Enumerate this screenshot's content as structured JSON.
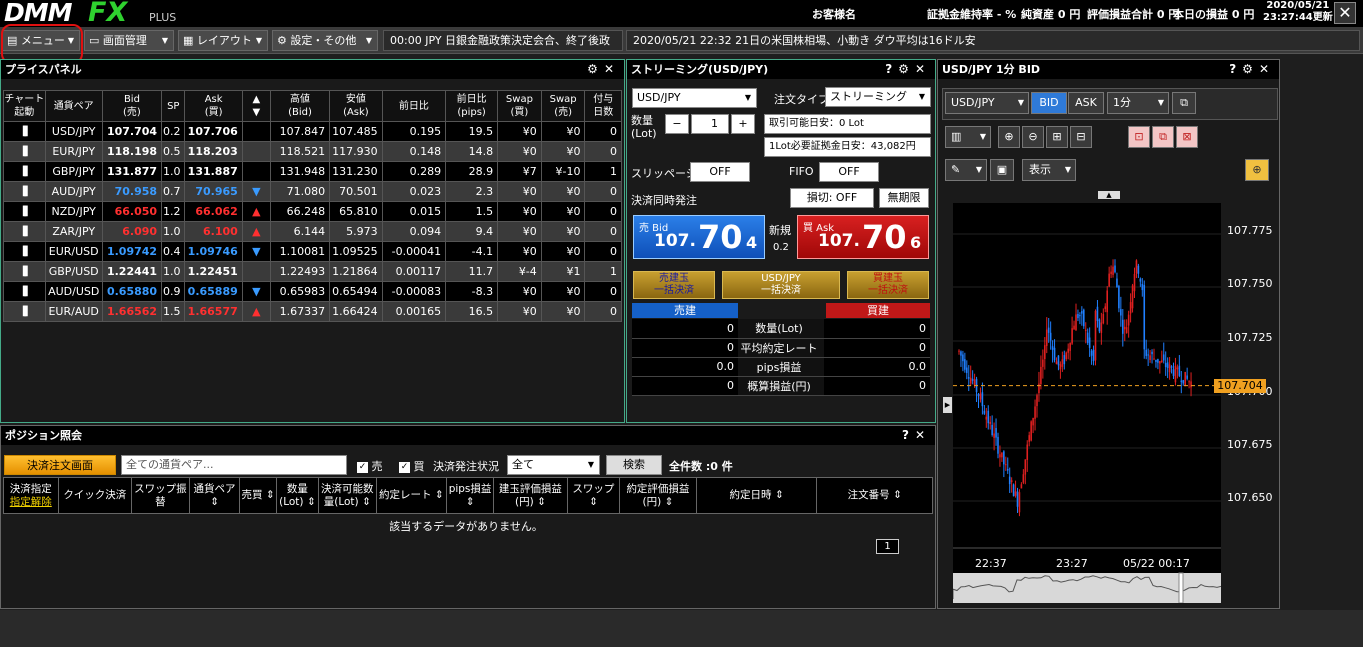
{
  "top": {
    "logo_dmm": "DMM",
    "logo_fx": "FX",
    "logo_plus": "PLUS",
    "customer": "お客様名",
    "margin_rate": "証拠金維持率 - %",
    "net_assets": "純資産 0 円",
    "unrealized": "評価損益合計 0 円",
    "today_pnl": "本日の損益 0 円",
    "date": "2020/05/21",
    "time": "23:27:44更新",
    "close": "✕"
  },
  "menu": {
    "items": [
      {
        "label": "メニュー",
        "icon": "grid-icon"
      },
      {
        "label": "画面管理",
        "icon": "monitor-icon"
      },
      {
        "label": "レイアウト",
        "icon": "layout-icon"
      },
      {
        "label": "設定・その他",
        "icon": "gear-icon"
      }
    ],
    "ticker1": "00:00  JPY  日銀金融政策決定会合、終了後政",
    "ticker2": "2020/05/21 22:32  21日の米国株相場、小動き  ダウ平均は16ドル安"
  },
  "price_panel": {
    "title": "プライスパネル",
    "headers": [
      "チャート起動",
      "通貨ペア",
      "Bid(売)",
      "SP",
      "Ask(買)",
      "▲▼",
      "高値(Bid)",
      "安値(Ask)",
      "前日比",
      "前日比(pips)",
      "Swap(買)",
      "Swap(売)",
      "付与日数"
    ],
    "rows": [
      {
        "pair": "USD/JPY",
        "bid": "107.704",
        "sp": "0.2",
        "ask": "107.706",
        "dir": "",
        "color": "white",
        "high": "107.847",
        "low": "107.485",
        "chg": "0.195",
        "pips": "19.5",
        "swap_buy": "¥0",
        "swap_sell": "¥0",
        "days": "0"
      },
      {
        "pair": "EUR/JPY",
        "bid": "118.198",
        "sp": "0.5",
        "ask": "118.203",
        "dir": "",
        "color": "white",
        "high": "118.521",
        "low": "117.930",
        "chg": "0.148",
        "pips": "14.8",
        "swap_buy": "¥0",
        "swap_sell": "¥0",
        "days": "0"
      },
      {
        "pair": "GBP/JPY",
        "bid": "131.877",
        "sp": "1.0",
        "ask": "131.887",
        "dir": "",
        "color": "white",
        "high": "131.948",
        "low": "131.230",
        "chg": "0.289",
        "pips": "28.9",
        "swap_buy": "¥7",
        "swap_sell": "¥-10",
        "days": "1"
      },
      {
        "pair": "AUD/JPY",
        "bid": "70.958",
        "sp": "0.7",
        "ask": "70.965",
        "dir": "▼",
        "color": "blue",
        "high": "71.080",
        "low": "70.501",
        "chg": "0.023",
        "pips": "2.3",
        "swap_buy": "¥0",
        "swap_sell": "¥0",
        "days": "0"
      },
      {
        "pair": "NZD/JPY",
        "bid": "66.050",
        "sp": "1.2",
        "ask": "66.062",
        "dir": "▲",
        "color": "red",
        "high": "66.248",
        "low": "65.810",
        "chg": "0.015",
        "pips": "1.5",
        "swap_buy": "¥0",
        "swap_sell": "¥0",
        "days": "0"
      },
      {
        "pair": "ZAR/JPY",
        "bid": "6.090",
        "sp": "1.0",
        "ask": "6.100",
        "dir": "▲",
        "color": "red",
        "high": "6.144",
        "low": "5.973",
        "chg": "0.094",
        "pips": "9.4",
        "swap_buy": "¥0",
        "swap_sell": "¥0",
        "days": "0"
      },
      {
        "pair": "EUR/USD",
        "bid": "1.09742",
        "sp": "0.4",
        "ask": "1.09746",
        "dir": "▼",
        "color": "blue",
        "high": "1.10081",
        "low": "1.09525",
        "chg": "-0.00041",
        "pips": "-4.1",
        "swap_buy": "¥0",
        "swap_sell": "¥0",
        "days": "0"
      },
      {
        "pair": "GBP/USD",
        "bid": "1.22441",
        "sp": "1.0",
        "ask": "1.22451",
        "dir": "",
        "color": "white",
        "high": "1.22493",
        "low": "1.21864",
        "chg": "0.00117",
        "pips": "11.7",
        "swap_buy": "¥-4",
        "swap_sell": "¥1",
        "days": "1"
      },
      {
        "pair": "AUD/USD",
        "bid": "0.65880",
        "sp": "0.9",
        "ask": "0.65889",
        "dir": "▼",
        "color": "blue",
        "high": "0.65983",
        "low": "0.65494",
        "chg": "-0.00083",
        "pips": "-8.3",
        "swap_buy": "¥0",
        "swap_sell": "¥0",
        "days": "0"
      },
      {
        "pair": "EUR/AUD",
        "bid": "1.66562",
        "sp": "1.5",
        "ask": "1.66577",
        "dir": "▲",
        "color": "red",
        "high": "1.67337",
        "low": "1.66424",
        "chg": "0.00165",
        "pips": "16.5",
        "swap_buy": "¥0",
        "swap_sell": "¥0",
        "days": "0"
      }
    ]
  },
  "streaming": {
    "title": "ストリーミング(USD/JPY)",
    "pair": "USD/JPY",
    "order_type_label": "注文タイプ",
    "order_type": "ストリーミング",
    "qty_label": "数量\n(Lot)",
    "qty": "1",
    "minus": "−",
    "plus": "+",
    "tradable": "取引可能日安：0 Lot",
    "required": "1Lot必要証拠金日安：43,082円",
    "slippage_label": "スリッページ",
    "slippage": "OFF",
    "fifo_label": "FIFO",
    "fifo": "OFF",
    "settle_label": "決済同時発注",
    "stoploss": "損切: OFF",
    "unlimited": "無期限",
    "bid_label": "売 Bid",
    "bid_main": "107.",
    "bid_big": "70",
    "bid_last": "4",
    "new_label": "新規",
    "spread": "0.2",
    "ask_label": "買 Ask",
    "ask_main": "107.",
    "ask_big": "70",
    "ask_last": "6",
    "sell_close": "売建玉\n一括決済",
    "pair_close": "USD/JPY\n一括決済",
    "buy_close": "買建玉\n一括決済",
    "sell_col": "売建",
    "buy_col": "買建",
    "summary": [
      {
        "label": "数量(Lot)",
        "sell": "0",
        "buy": "0"
      },
      {
        "label": "平均約定レート",
        "sell": "0",
        "buy": "0"
      },
      {
        "label": "pips損益",
        "sell": "0.0",
        "buy": "0.0"
      },
      {
        "label": "概算損益(円)",
        "sell": "0",
        "buy": "0"
      }
    ]
  },
  "chart": {
    "title": "USD/JPY 1分 BID",
    "pair": "USD/JPY",
    "bid": "BID",
    "ask": "ASK",
    "interval": "1分",
    "display": "表示",
    "price_labels": [
      "107.775",
      "107.750",
      "107.725",
      "107.700",
      "107.675",
      "107.650"
    ],
    "current": "107.704",
    "time_labels": [
      "22:37",
      "23:27",
      "05/22 00:17"
    ]
  },
  "position": {
    "title": "ポジション照会",
    "settle_btn": "決済注文画面",
    "pair_placeholder": "全ての通貨ペア...",
    "sell_label": "売",
    "buy_label": "買",
    "status_label": "決済発注状況",
    "status_value": "全て",
    "search": "検索",
    "count": "全件数 :0 件",
    "headers": [
      "決済指定",
      "クイック決済",
      "スワップ振替",
      "通貨ペア",
      "売買",
      "数量(Lot)",
      "決済可能数量(Lot)",
      "約定レート",
      "pips損益",
      "建玉評価損益(円)",
      "スワップ",
      "約定評価損益(円)",
      "約定日時",
      "注文番号"
    ],
    "designate_clear": "指定解除",
    "empty": "該当するデータがありません。",
    "page": "1"
  }
}
